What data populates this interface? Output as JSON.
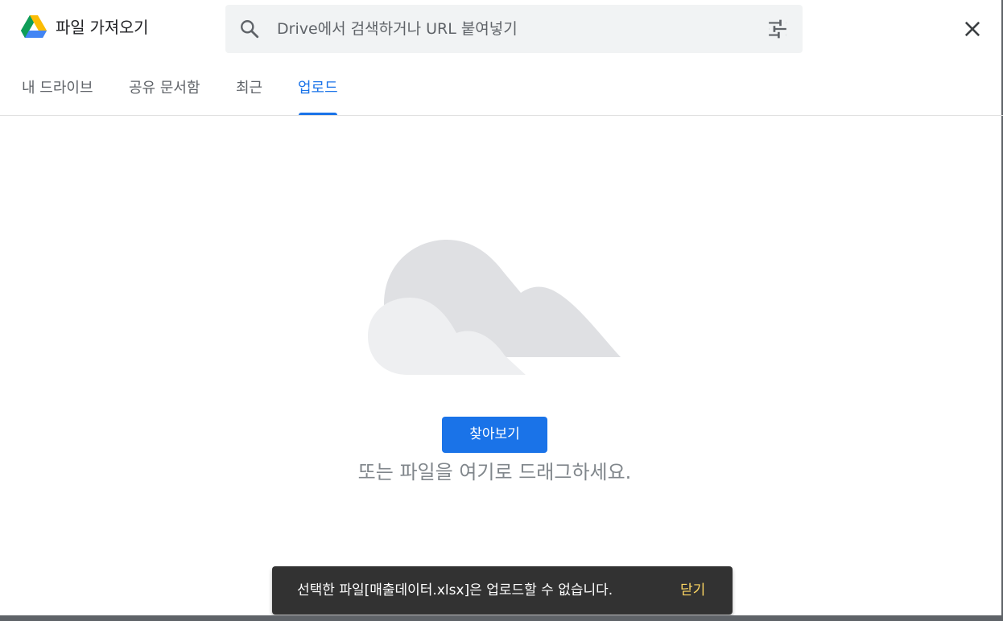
{
  "header": {
    "title": "파일 가져오기",
    "logo_icon": "google-drive-logo",
    "search": {
      "placeholder": "Drive에서 검색하거나 URL 붙여넣기",
      "value": "",
      "search_icon": "search-icon",
      "options_icon": "tune-icon"
    },
    "close_icon": "close-icon"
  },
  "tabs": [
    {
      "label": "내 드라이브",
      "active": false
    },
    {
      "label": "공유 문서함",
      "active": false
    },
    {
      "label": "최근",
      "active": false
    },
    {
      "label": "업로드",
      "active": true
    }
  ],
  "upload": {
    "illustration": "cloud-illustration",
    "browse_label": "찾아보기",
    "drag_hint": "또는 파일을 여기로 드래그하세요."
  },
  "snackbar": {
    "message": "선택한 파일[매출데이터.xlsx]은 업로드할 수 없습니다.",
    "action_label": "닫기"
  },
  "colors": {
    "accent": "#1a73e8",
    "tab_inactive": "#5f6368",
    "snackbar_bg": "#323232",
    "snackbar_action": "#fdd663",
    "search_bg": "#f1f3f4"
  }
}
